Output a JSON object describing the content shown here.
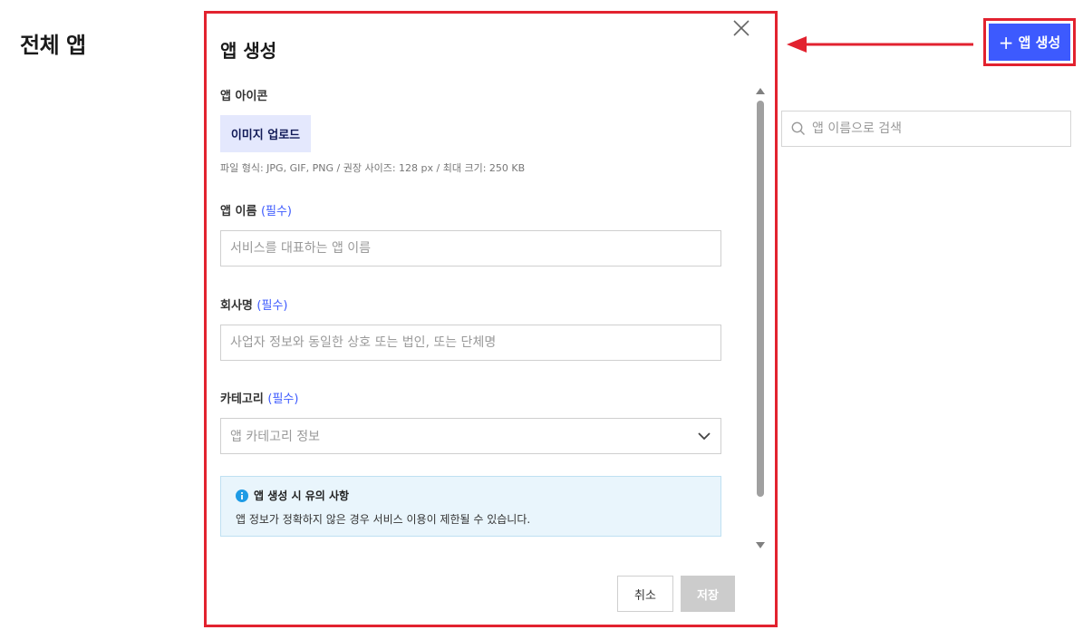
{
  "page": {
    "title": "전체 앱",
    "create_button_label": "앱 생성",
    "search_placeholder": "앱 이름으로 검색"
  },
  "modal": {
    "title": "앱 생성",
    "icon_section": {
      "label": "앱 아이콘",
      "upload_label": "이미지 업로드",
      "hint": "파일 형식: JPG, GIF, PNG / 권장 사이즈: 128 px / 최대 크기: 250 KB"
    },
    "name_field": {
      "label": "앱 이름",
      "required": "(필수)",
      "placeholder": "서비스를 대표하는 앱 이름"
    },
    "company_field": {
      "label": "회사명",
      "required": "(필수)",
      "placeholder": "사업자 정보와 동일한 상호 또는 법인, 또는 단체명"
    },
    "category_field": {
      "label": "카테고리",
      "required": "(필수)",
      "placeholder": "앱 카테고리 정보"
    },
    "notice": {
      "title": "앱 생성 시 유의 사항",
      "body": "앱 정보가 정확하지 않은 경우 서비스 이용이 제한될 수 있습니다."
    },
    "cancel_label": "취소",
    "save_label": "저장"
  },
  "colors": {
    "primary": "#3d5afe",
    "highlight": "#e2222f",
    "notice_bg": "#e9f5fc",
    "info_icon": "#1e9be5"
  }
}
